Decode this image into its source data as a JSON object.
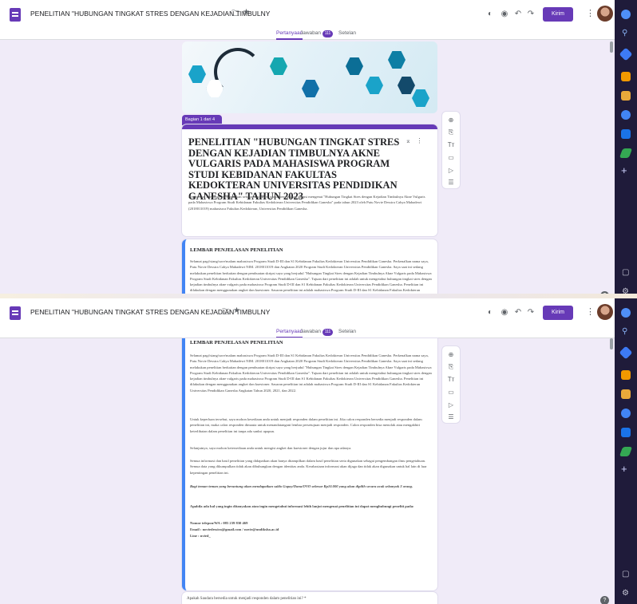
{
  "app": {
    "doc_title": "PENELITIAN \"HUBUNGAN TINGKAT STRES DENGAN KEJADIAN TIMBULNY",
    "doc_title_2": "PENELITIAN \"HUBUNGAN TINGKAT STRES DENGAN KEJADIAN TIMBULNY",
    "send_label": "Kirim",
    "tabs": [
      {
        "label": "Pertanyaan"
      },
      {
        "label": "Jawaban"
      },
      {
        "label": "Setelan"
      }
    ],
    "response_count": "111"
  },
  "form": {
    "section_label": "Bagian 1 dari 4",
    "title": "PENELITIAN \"HUBUNGAN TINGKAT STRES DENGAN KEJADIAN TIMBULNYA AKNE VULGARIS PADA MAHASISWA PROGRAM STUDI KEBIDANAN FAKULTAS KEDOKTERAN UNIVERSITAS PENDIDIKAN GANESHA\" TAHUN 2023",
    "description": "Angket dan kuesioner ini digunakan sebagai instrumen untuk penyusunan skripsi mengenai \"Hubungan Tingkat Stres dengan Kejadian Timbulnya Akne Vulgaris pada Mahasiswa Program Studi Kebidanan Fakultas Kedokteran Universitas Pendidikan Ganesha\" pada tahun 2023 oleh Putu Novie Dessira Cahya Mahadewi (2018011019) mahasiswa Fakultas Kedokteran, Universitas Pendidikan Ganesha.",
    "lembar": {
      "title": "LEMBAR PENJELASAN PENELITIAN",
      "p1": "Selamat pagi/siang/sore/malam mahasiswa Program Studi D-III dan S1 Kebidanan Fakultas Kedokteran Universitas Pendidikan Ganesha. Perkenalkan nama saya, Putu Novie Dessira Cahya Mahadewi NIM. 2018011019 dan Angkatan 2020 Program Studi Kedokteran Universitas Pendidikan Ganesha. Saya saat ini sedang melakukan penelitian berkaitan dengan pembuatan skripsi saya yang berjudul \"Hubungan Tingkat Stres dengan Kejadian Timbulnya Akne Vulgaris pada Mahasiswa Program Studi Kebidanan Fakultas Kedokteran Universitas Pendidikan Ganesha\". Tujuan dari penelitian ini adalah untuk mengetahui hubungan tingkat stres dengan kejadian timbulnya akne vulgaris pada mahasiswa Program Studi D-III dan S1 Kebidanan Fakultas Kedokteran Universitas Pendidikan Ganesha. Penelitian ini dilakukan dengan menggunakan angket dan kuesioner. Sasaran penelitian ini adalah mahasiswa Program Studi D-III dan S1 Kebidanan Fakultas Kedokteran Universitas Pendidikan Ganesha Angkatan Tahun 2020, 2021, dan 2022.",
      "p2": "Untuk keperluan tersebut, saya mohon kesediaan anda untuk menjadi responden dalam penelitian ini. Jika calon responden bersedia menjadi responden dalam penelitian ini, maka calon responden dimauta untuk menandatangani lembar persetujuan menjadi responden. Calon responden bisa menolak atau mengakhiri keterlibatan dalam penelitian ini tanpa ada sanksi apapun.",
      "p3": "Selanjutnya, saya mohon ketersediaan anda untuk mengisi angket dan kuesioner dengan jujur dan apa adanya.",
      "p4": "Semua informasi dan hasil penelitian yang didapatkan akan hanya ditampilkan dalam hasil penelitian serta digunakan sebagai pengembangan ilmu pengetahuan. Semua data yang dikumpulkan tidak akan dibuhungkan dengan identitas anda. Kerahasiaan informasi akan dijaga dan tidak akan digunakan untuk hal lain di luar kepentingan penelitian ini.",
      "p5": "Bagi teman-teman yang beruntung akan mendapatkan saldo Gopay/Dana/OVO sebesar Rp10.000 yang akan dipilih secara acak sebanyak 3 orang.",
      "p6": "Apabila ada hal yang ingin ditanyakan atau ingin mengetahui informasi lebih lanjut mengenai penelitian ini dapat menghubungi peneliti pada:",
      "contact1": "Nomor telepon/WA : 085 239 830 469",
      "contact2": "Email : noviedessira@gmail.com / novie@undiksha.ac.id",
      "contact3": "Line : nvied_"
    },
    "next_question": "Apakah Saudara bersedia untuk menjadi responden dalam penelitian ini? *"
  },
  "icons": {
    "folder": "folder-icon",
    "star": "star-icon",
    "palette": "palette-icon",
    "preview": "eye-icon",
    "undo": "undo-icon",
    "redo": "redo-icon",
    "more": "more-vert-icon"
  },
  "colors": {
    "accent": "#673ab7",
    "section_border": "#4285f4",
    "rail": "#1f1b3a"
  }
}
